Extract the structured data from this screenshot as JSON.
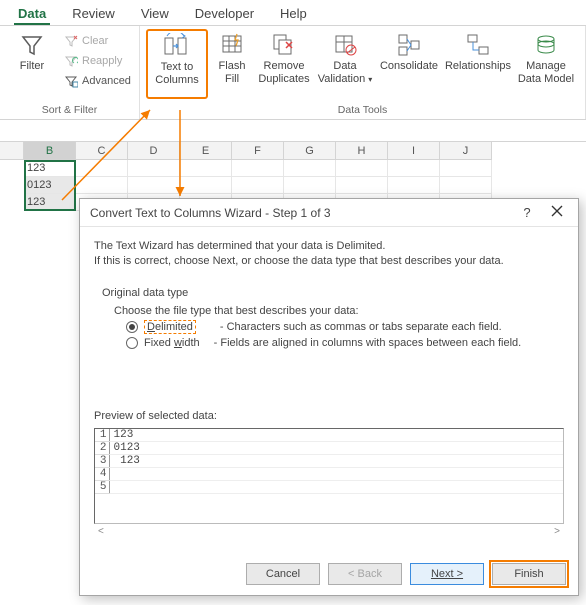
{
  "tabs": {
    "data": "Data",
    "review": "Review",
    "view": "View",
    "developer": "Developer",
    "help": "Help"
  },
  "ribbon": {
    "sortfilter": {
      "filter": "Filter",
      "clear": "Clear",
      "reapply": "Reapply",
      "advanced": "Advanced",
      "group_label": "Sort & Filter"
    },
    "datatools": {
      "text_to_columns_l1": "Text to",
      "text_to_columns_l2": "Columns",
      "flash_fill_l1": "Flash",
      "flash_fill_l2": "Fill",
      "remove_dup_l1": "Remove",
      "remove_dup_l2": "Duplicates",
      "data_val_l1": "Data",
      "data_val_l2": "Validation",
      "consolidate": "Consolidate",
      "relationships": "Relationships",
      "manage_l1": "Manage",
      "manage_l2": "Data Model",
      "group_label": "Data Tools"
    }
  },
  "grid": {
    "cols": [
      "B",
      "C",
      "D",
      "E",
      "F",
      "G",
      "H",
      "I",
      "J"
    ],
    "cells": [
      "123",
      "0123",
      " 123"
    ]
  },
  "dialog": {
    "title": "Convert Text to Columns Wizard - Step 1 of 3",
    "help_symbol": "?",
    "line1": "The Text Wizard has determined that your data is Delimited.",
    "line2": "If this is correct, choose Next, or choose the data type that best describes your data.",
    "original_data_type": "Original data type",
    "choose_prompt": "Choose the file type that best describes your data:",
    "delimited_u": "D",
    "delimited_rest": "elimited",
    "delimited_desc": "- Characters such as commas or tabs separate each field.",
    "fixed_pre": "Fixed ",
    "fixed_u": "w",
    "fixed_post": "idth",
    "fixed_desc": "- Fields are aligned in columns with spaces between each field.",
    "preview_label": "Preview of selected data:",
    "preview": [
      {
        "n": "1",
        "v": "123"
      },
      {
        "n": "2",
        "v": "0123"
      },
      {
        "n": "3",
        "v": " 123"
      },
      {
        "n": "4",
        "v": ""
      },
      {
        "n": "5",
        "v": ""
      }
    ],
    "buttons": {
      "cancel": "Cancel",
      "back": "< Back",
      "next": "Next >",
      "finish": "Finish"
    }
  }
}
